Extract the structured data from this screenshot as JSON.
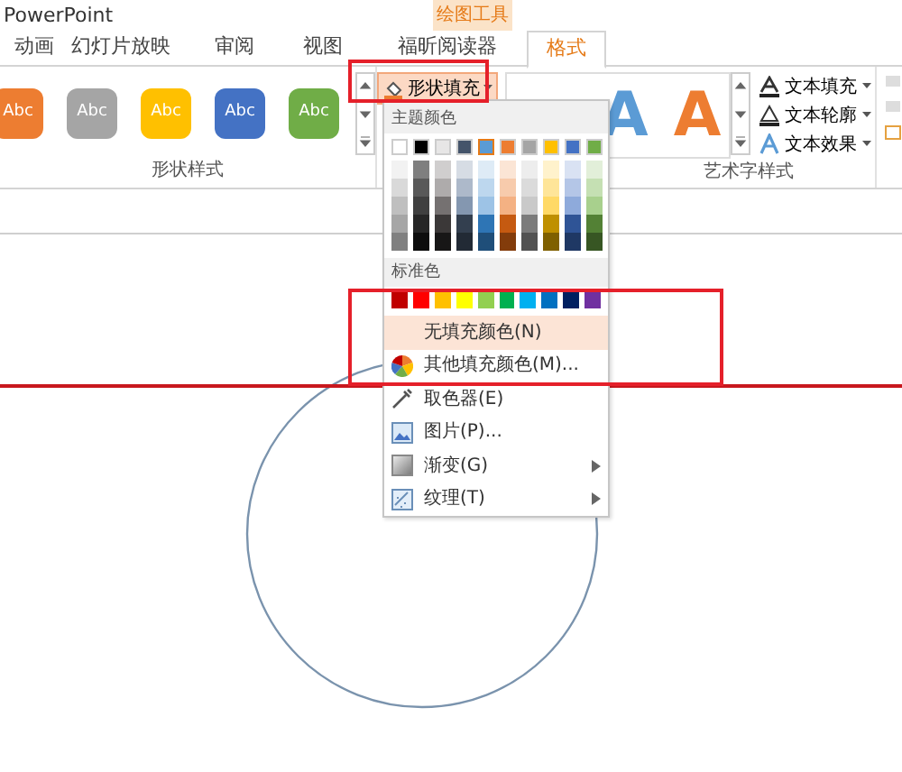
{
  "window": {
    "title": "PowerPoint"
  },
  "contextual_tab_group": {
    "label": "绘图工具"
  },
  "tabs": [
    {
      "label": "动画",
      "selected": false
    },
    {
      "label": "幻灯片放映",
      "selected": false
    },
    {
      "label": "审阅",
      "selected": false
    },
    {
      "label": "视图",
      "selected": false
    },
    {
      "label": "福昕阅读器",
      "selected": false
    },
    {
      "label": "格式",
      "selected": true
    }
  ],
  "ribbon": {
    "shape_styles": {
      "swatches": [
        {
          "label": "Abc",
          "color": "#ed7d31"
        },
        {
          "label": "Abc",
          "color": "#a5a5a5"
        },
        {
          "label": "Abc",
          "color": "#ffc000"
        },
        {
          "label": "Abc",
          "color": "#4472c4"
        },
        {
          "label": "Abc",
          "color": "#70ad47"
        }
      ],
      "group_label": "形状样式"
    },
    "shape_fill_button": {
      "label": "形状填充"
    },
    "wordart_styles": {
      "samples": [
        {
          "label": "A",
          "color": "#5b9bd5"
        },
        {
          "label": "A",
          "color": "#ed7d31"
        }
      ],
      "commands": [
        {
          "label": "文本填充",
          "kind": "fill"
        },
        {
          "label": "文本轮廓",
          "kind": "outline"
        },
        {
          "label": "文本效果",
          "kind": "effects"
        }
      ],
      "group_label": "艺术字样式"
    }
  },
  "fill_menu": {
    "theme_heading": "主题颜色",
    "theme_colors": [
      {
        "color": "#ffffff",
        "selected": false,
        "shades": [
          {
            "color": "#f2f2f2"
          },
          {
            "color": "#d9d9d9"
          },
          {
            "color": "#bfbfbf"
          },
          {
            "color": "#a6a6a6"
          },
          {
            "color": "#808080"
          }
        ]
      },
      {
        "color": "#000000",
        "selected": false,
        "shades": [
          {
            "color": "#7f7f7f"
          },
          {
            "color": "#595959"
          },
          {
            "color": "#404040"
          },
          {
            "color": "#262626"
          },
          {
            "color": "#0d0d0d"
          }
        ]
      },
      {
        "color": "#e7e6e6",
        "selected": false,
        "shades": [
          {
            "color": "#d0cece"
          },
          {
            "color": "#aeabab"
          },
          {
            "color": "#757171"
          },
          {
            "color": "#3b3838"
          },
          {
            "color": "#171616"
          }
        ]
      },
      {
        "color": "#44546a",
        "selected": false,
        "shades": [
          {
            "color": "#d6dce4"
          },
          {
            "color": "#adb9ca"
          },
          {
            "color": "#8497b0"
          },
          {
            "color": "#333f4f"
          },
          {
            "color": "#222a35"
          }
        ]
      },
      {
        "color": "#5b9bd5",
        "selected": true,
        "shades": [
          {
            "color": "#deebf6"
          },
          {
            "color": "#bdd7ee"
          },
          {
            "color": "#9dc3e6"
          },
          {
            "color": "#2e75b5"
          },
          {
            "color": "#1f4e79"
          }
        ]
      },
      {
        "color": "#ed7d31",
        "selected": false,
        "shades": [
          {
            "color": "#fbe5d5"
          },
          {
            "color": "#f7cbac"
          },
          {
            "color": "#f4b183"
          },
          {
            "color": "#c55a11"
          },
          {
            "color": "#833c0b"
          }
        ]
      },
      {
        "color": "#a5a5a5",
        "selected": false,
        "shades": [
          {
            "color": "#ededed"
          },
          {
            "color": "#dbdbdb"
          },
          {
            "color": "#c9c9c9"
          },
          {
            "color": "#7b7b7b"
          },
          {
            "color": "#525252"
          }
        ]
      },
      {
        "color": "#ffc000",
        "selected": false,
        "shades": [
          {
            "color": "#fff2cc"
          },
          {
            "color": "#fee599"
          },
          {
            "color": "#ffd966"
          },
          {
            "color": "#bf9000"
          },
          {
            "color": "#7f6000"
          }
        ]
      },
      {
        "color": "#4472c4",
        "selected": false,
        "shades": [
          {
            "color": "#d9e2f3"
          },
          {
            "color": "#b4c6e7"
          },
          {
            "color": "#8eaadb"
          },
          {
            "color": "#2f5496"
          },
          {
            "color": "#1f3864"
          }
        ]
      },
      {
        "color": "#70ad47",
        "selected": false,
        "shades": [
          {
            "color": "#e2efd9"
          },
          {
            "color": "#c5e0b3"
          },
          {
            "color": "#a8d08d"
          },
          {
            "color": "#538135"
          },
          {
            "color": "#375623"
          }
        ]
      }
    ],
    "standard_heading": "标准色",
    "standard_colors": [
      {
        "color": "#c00000"
      },
      {
        "color": "#ff0000"
      },
      {
        "color": "#ffc000"
      },
      {
        "color": "#ffff00"
      },
      {
        "color": "#92d050"
      },
      {
        "color": "#00b050"
      },
      {
        "color": "#00b0f0"
      },
      {
        "color": "#0070c0"
      },
      {
        "color": "#002060"
      },
      {
        "color": "#7030a0"
      }
    ],
    "items": [
      {
        "label": "无填充颜色(N)",
        "kind": "none",
        "selected": true,
        "has_submenu": false
      },
      {
        "label": "其他填充颜色(M)...",
        "kind": "palette",
        "selected": false,
        "has_submenu": false
      },
      {
        "label": "取色器(E)",
        "kind": "eyedropper",
        "selected": false,
        "has_submenu": false
      },
      {
        "label": "图片(P)...",
        "kind": "picture",
        "selected": false,
        "has_submenu": false
      },
      {
        "label": "渐变(G)",
        "kind": "gradient",
        "selected": false,
        "has_submenu": true
      },
      {
        "label": "纹理(T)",
        "kind": "texture",
        "selected": false,
        "has_submenu": true
      }
    ]
  }
}
